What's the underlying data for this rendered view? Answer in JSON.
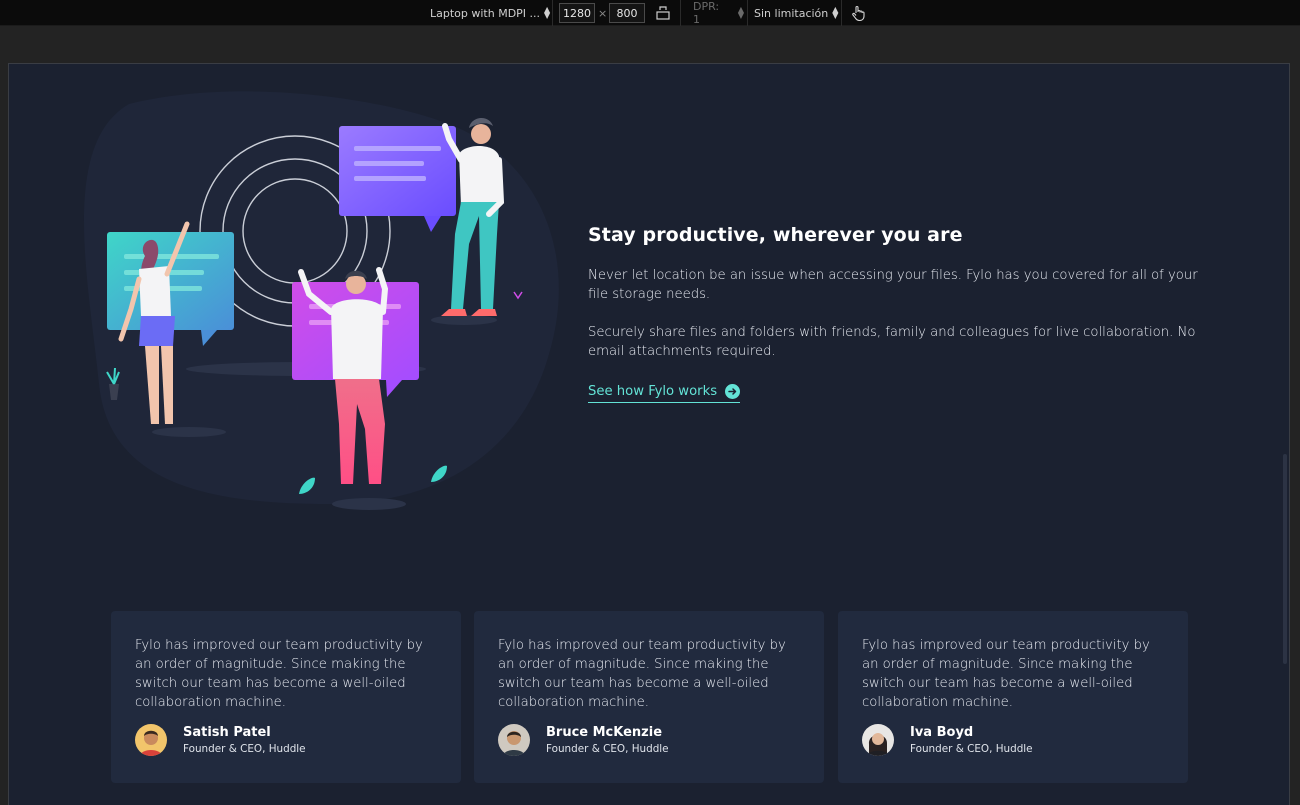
{
  "devtools": {
    "device": "Laptop with MDPI ...",
    "width": "1280",
    "times": "×",
    "height": "800",
    "dpr": "DPR: 1",
    "throttle": "Sin limitación"
  },
  "productive": {
    "title": "Stay productive, wherever you are",
    "paragraph1": "Never let location be an issue when accessing your files. Fylo has you covered for all of your file storage needs.",
    "paragraph2": "Securely share files and folders with friends, family and colleagues for live collaboration. No email attachments required.",
    "link_label": "See how Fylo works"
  },
  "testimonials": [
    {
      "quote": "Fylo has improved our team productivity by an order of magnitude. Since making the switch our team has become a well-oiled collaboration machine.",
      "name": "Satish Patel",
      "role": "Founder & CEO, Huddle"
    },
    {
      "quote": "Fylo has improved our team productivity by an order of magnitude. Since making the switch our team has become a well-oiled collaboration machine.",
      "name": "Bruce McKenzie",
      "role": "Founder & CEO, Huddle"
    },
    {
      "quote": "Fylo has improved our team productivity by an order of magnitude. Since making the switch our team has become a well-oiled collaboration machine.",
      "name": "Iva Boyd",
      "role": "Founder & CEO, Huddle"
    }
  ],
  "colors": {
    "background": "#1b2130",
    "card": "#212a3e",
    "accent": "#63e3d6"
  }
}
